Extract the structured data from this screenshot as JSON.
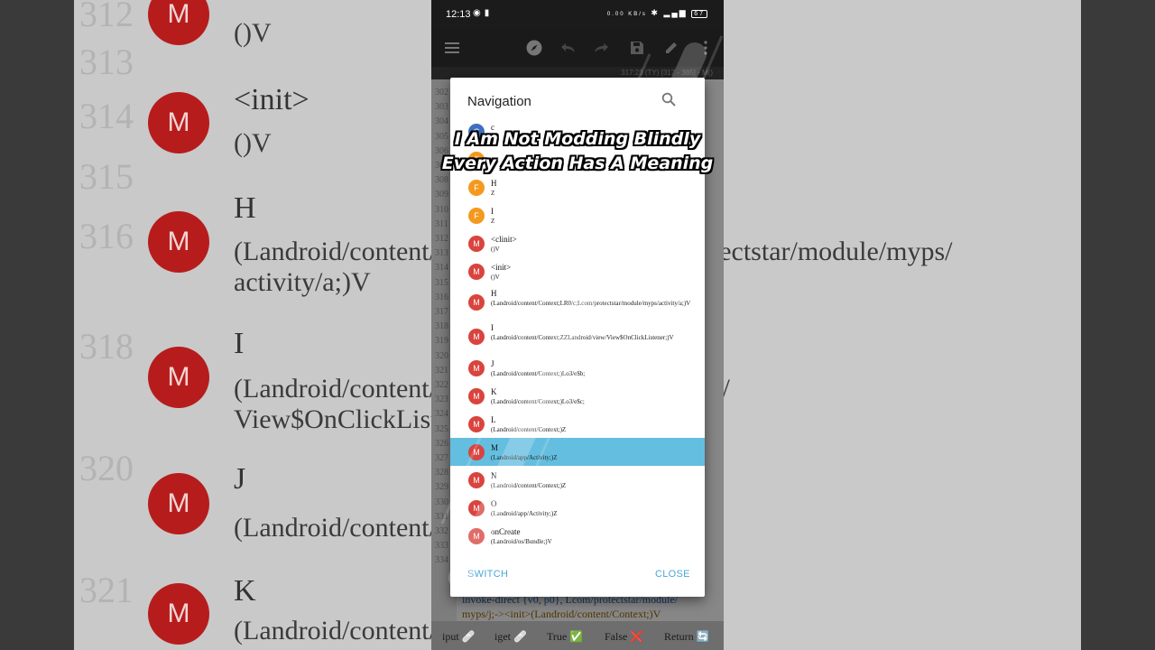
{
  "background": {
    "rows": [
      {
        "num": "312",
        "sig": "()V",
        "name": "",
        "badge": "M"
      },
      {
        "num": "313",
        "name": "",
        "sig": "",
        "badge": ""
      },
      {
        "num": "314",
        "name": "<init>",
        "sig": "()V",
        "badge": "M"
      },
      {
        "num": "315",
        "name": "",
        "sig": "",
        "badge": ""
      },
      {
        "num": "316",
        "name": "H",
        "sig": "(Landroid/content/Context;LR0/c;Lcom/protectstar/module/myps/",
        "sig2": "activity/a;)V",
        "badge": "M"
      },
      {
        "num": "318",
        "name": "I",
        "sig": "(Landroid/content/Context;ZZLandroid/view/",
        "sig2": "View$OnClickListener;)V",
        "badge": "M"
      },
      {
        "num": "320",
        "name": "J",
        "sig": "(Landroid/content/Context;)Lo3/e$b;",
        "badge": "M"
      },
      {
        "num": "321",
        "name": "K",
        "sig": "(Landroid/content/Context;)Lo3/e$c;",
        "badge": "M"
      }
    ]
  },
  "status_bar": {
    "time": "12:13",
    "net_speed": "0.00 KB/s",
    "battery": "67"
  },
  "toolbar": {
    "icons": [
      "menu-icon",
      "compass-icon",
      "undo-icon",
      "redo-icon",
      "save-icon",
      "edit-icon",
      "more-icon"
    ]
  },
  "path_bar": {
    "position": "317:23 (TY) [317 - 385] - M()"
  },
  "editor": {
    "line_numbers": [
      "302",
      "303",
      "304",
      "305",
      "306",
      "307",
      "308",
      "309",
      "310",
      "311",
      "312",
      "313",
      "314",
      "315",
      "316",
      "317",
      "318",
      "319",
      "320",
      "321",
      "322",
      "323",
      "324",
      "325",
      "326",
      "327",
      "328",
      "329",
      "330",
      "331",
      "332",
      "333",
      "334"
    ],
    "code_lines": [
      {
        "text": "invoke-direct {v0, p0}, Lcom/protectstar/module/"
      },
      {
        "text": "myps/j;-><init>(Landroid/content/Context;)V"
      }
    ]
  },
  "bottom_bar": {
    "items": [
      {
        "label": "iput 🩹"
      },
      {
        "label": "iget 🩹"
      },
      {
        "label": "True ✅"
      },
      {
        "label": "False ❌"
      },
      {
        "label": "Return 🔄"
      }
    ]
  },
  "dialog": {
    "title": "Navigation",
    "items": [
      {
        "badge": "C",
        "kind": "c",
        "name": "c",
        "sig": ""
      },
      {
        "badge": "F",
        "kind": "f",
        "name": "",
        "sig": ""
      },
      {
        "badge": "F",
        "kind": "f",
        "name": "H",
        "sig": "Z"
      },
      {
        "badge": "F",
        "kind": "f",
        "name": "I",
        "sig": "Z"
      },
      {
        "badge": "M",
        "kind": "m",
        "name": "<clinit>",
        "sig": "()V"
      },
      {
        "badge": "M",
        "kind": "m",
        "name": "<init>",
        "sig": "()V"
      },
      {
        "badge": "M",
        "kind": "m",
        "name": "H",
        "sig": "(Landroid/content/Context;LR0/c;Lcom/protectstar/module/myps/activity/a;)V"
      },
      {
        "badge": "M",
        "kind": "m",
        "name": "I",
        "sig": "(Landroid/content/Context;ZZLandroid/view/View$OnClickListener;)V"
      },
      {
        "badge": "M",
        "kind": "m",
        "name": "J",
        "sig": "(Landroid/content/Context;)Lo3/e$b;"
      },
      {
        "badge": "M",
        "kind": "m",
        "name": "K",
        "sig": "(Landroid/content/Context;)Lo3/e$c;"
      },
      {
        "badge": "M",
        "kind": "m",
        "name": "L",
        "sig": "(Landroid/content/Context;)Z"
      },
      {
        "badge": "M",
        "kind": "m",
        "name": "M",
        "sig": "(Landroid/app/Activity;)Z",
        "selected": true
      },
      {
        "badge": "M",
        "kind": "m",
        "name": "N",
        "sig": "(Landroid/content/Context;)Z"
      },
      {
        "badge": "M",
        "kind": "m",
        "name": "O",
        "sig": "(Landroid/app/Activity;)Z"
      },
      {
        "badge": "M",
        "kind": "m",
        "name": "onCreate",
        "sig": "(Landroid/os/Bundle;)V"
      }
    ],
    "switch_label": "SWITCH",
    "close_label": "CLOSE"
  },
  "caption": {
    "line1": "I Am Not Modding Blindly",
    "line2": "Every Action Has A Meaning"
  },
  "colors": {
    "method_badge": "#d9443e",
    "field_badge": "#f39a1e",
    "class_badge": "#3f6fc0",
    "selected_row": "#64bedf",
    "button_text": "#4aa7d8"
  }
}
